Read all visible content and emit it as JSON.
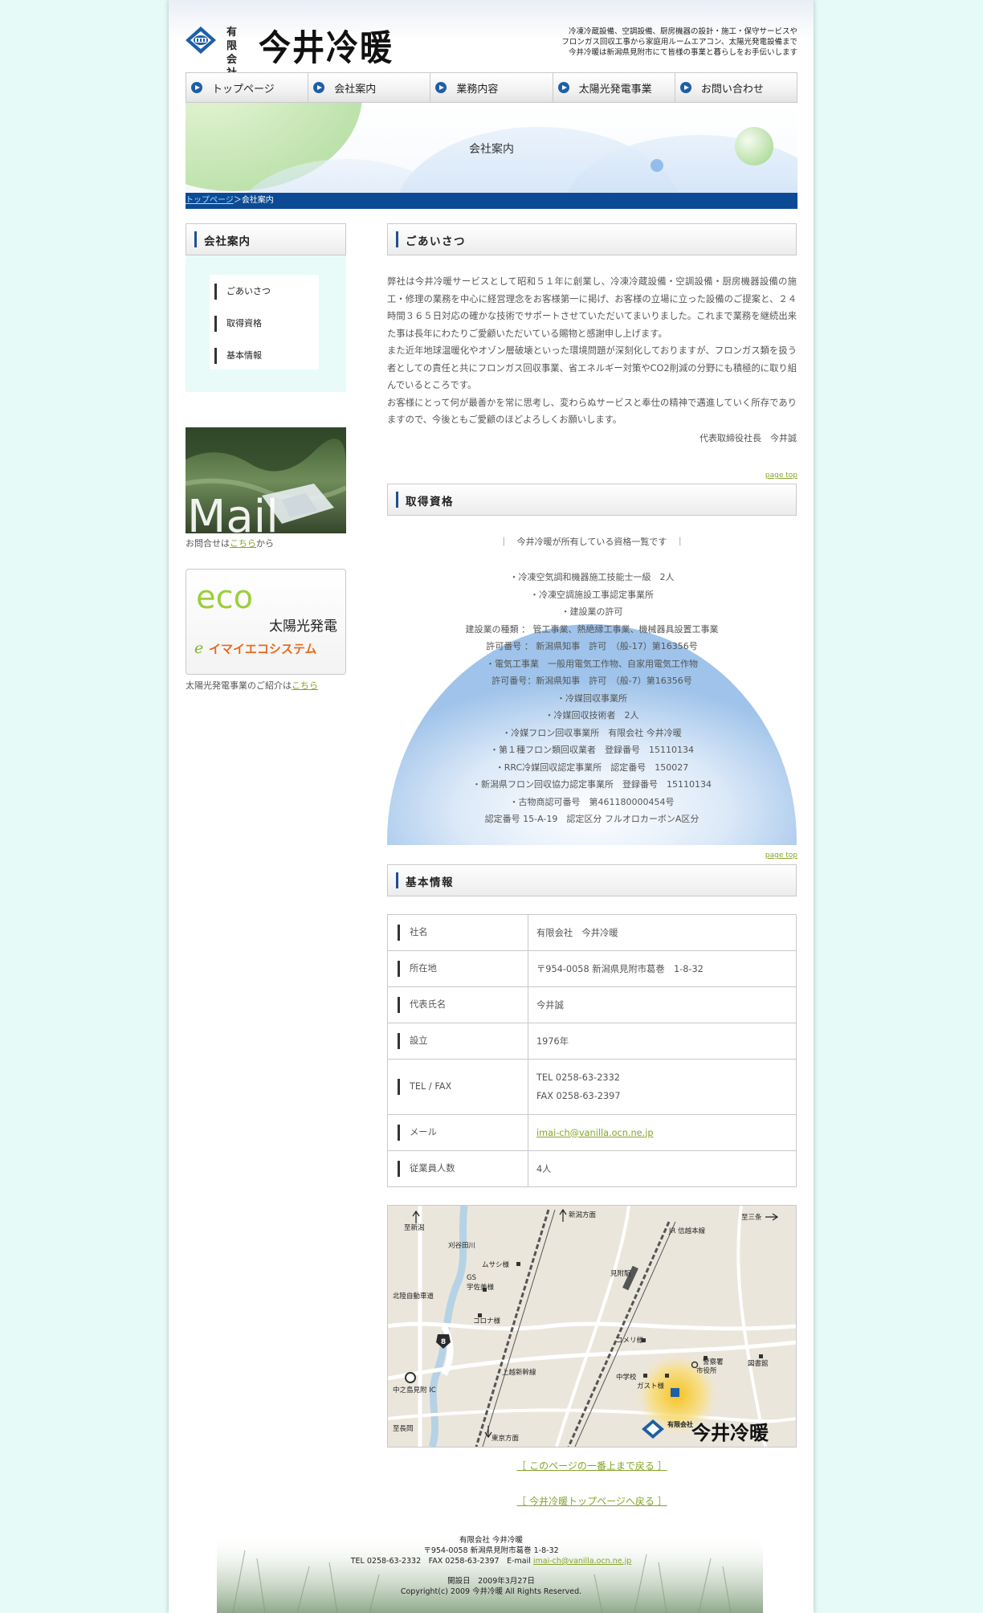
{
  "header": {
    "company_type": "有限会社",
    "company_name": "今井冷暖",
    "tagline": [
      "冷凍冷蔵設備、空調設備、厨房機器の設計・施工・保守サービスや",
      "フロンガス回収工事から家庭用ルームエアコン、太陽光発電設備まで",
      "今井冷暖は新潟県見附市にて皆様の事業と暮らしをお手伝いします"
    ]
  },
  "nav": {
    "items": [
      {
        "label": "トップページ",
        "icon": "arrow-circle-icon"
      },
      {
        "label": "会社案内",
        "icon": "arrow-circle-icon"
      },
      {
        "label": "業務内容",
        "icon": "arrow-circle-icon"
      },
      {
        "label": "太陽光発電事業",
        "icon": "arrow-circle-icon"
      },
      {
        "label": "お問い合わせ",
        "icon": "arrow-circle-icon"
      }
    ]
  },
  "banner": {
    "title": "会社案内"
  },
  "breadcrumb": {
    "home": "トップページ",
    "separator": "＞",
    "current": "会社案内"
  },
  "sidebar": {
    "heading": "会社案内",
    "menu": [
      "ごあいさつ",
      "取得資格",
      "基本情報"
    ],
    "mail_banner": {
      "text": "Mail"
    },
    "mail_note": {
      "prefix": "お問合せは",
      "link": "こちら",
      "suffix": "から"
    },
    "eco_banner": {
      "eco": "eco",
      "solar": "太陽光発電",
      "brand": "イマイエコシステム"
    },
    "eco_note": {
      "prefix": "太陽光発電事業のご紹介は",
      "link": "こちら"
    }
  },
  "greeting": {
    "heading": "ごあいさつ",
    "paragraphs": [
      "弊社は今井冷暖サービスとして昭和５１年に創業し、冷凍冷蔵設備・空調設備・厨房機器設備の施工・修理の業務を中心に経営理念をお客様第一に掲げ、お客様の立場に立った設備のご提案と、２４時間３６５日対応の確かな技術でサポートさせていただいてまいりました。これまで業務を継続出来た事は長年にわたりご愛顧いただいている賜物と感謝申し上げます。",
      "また近年地球温暖化やオゾン層破壊といった環境問題が深刻化しておりますが、フロンガス類を扱う者としての責任と共にフロンガス回収事業、省エネルギー対策やCO2削減の分野にも積極的に取り組んでいるところです。",
      "お客様にとって何が最善かを常に思考し、変わらぬサービスと奉仕の精神で邁進していく所存でありますので、今後ともご愛顧のほどよろしくお願いします。"
    ],
    "signature": "代表取締役社長　今井誠",
    "pagetop": "page top"
  },
  "qualifications": {
    "heading": "取得資格",
    "intro": "｜　今井冷暖が所有している資格一覧です　｜",
    "items": [
      "・冷凍空気調和機器施工技能士一級　2人",
      "・冷凍空調施設工事認定事業所",
      "・建設業の許可",
      "建設業の種類 ： 管工事業、熱絶縁工事業、機械器具設置工事業",
      "許可番号 ： 新潟県知事　許可　（般-17）第16356号",
      "・電気工事業　一般用電気工作物、自家用電気工作物",
      "許可番号：新潟県知事　許可　（般-7）第16356号",
      "・冷媒回収事業所",
      "・冷媒回収技術者　2人",
      "・冷媒フロン回収事業所　有限会社 今井冷暖",
      "・第１種フロン類回収業者　登録番号　15110134",
      "・RRC冷媒回収認定事業所　認定番号　150027",
      "・新潟県フロン回収協力認定事業所　登録番号　15110134",
      "・古物商認可番号　第461180000454号",
      "認定番号 15-A-19　認定区分 フルオロカーボンA区分"
    ],
    "pagetop": "page top"
  },
  "basic_info": {
    "heading": "基本情報",
    "rows": [
      {
        "key": "社名",
        "value": "有限会社　今井冷暖"
      },
      {
        "key": "所在地",
        "value": "〒954-0058 新潟県見附市葛巻　1-8-32"
      },
      {
        "key": "代表氏名",
        "value": "今井誠"
      },
      {
        "key": "設立",
        "value": "1976年"
      },
      {
        "key": "TEL / FAX",
        "value": "TEL 0258-63-2332",
        "value2": "FAX 0258-63-2397"
      },
      {
        "key": "メール",
        "value": "imai-ch@vanilla.ocn.ne.jp"
      },
      {
        "key": "従業員人数",
        "value": "4人"
      }
    ]
  },
  "map": {
    "labels": {
      "shiniwako": "至新潟",
      "niigata_dir": "新潟方面",
      "jr": "JR 信越本線",
      "sanjo": "至三条",
      "kariyata": "刈谷田川",
      "musashi": "ムサシ様",
      "gs": "GS",
      "usami": "宇佐美様",
      "mitsuke_st": "見附駅",
      "hokuriku": "北陸自動車道",
      "corona": "コロナ様",
      "route": "8",
      "komeri": "コメリ様",
      "police": "警察署",
      "cityhall": "市役所",
      "library": "図書館",
      "joetsu": "上越新幹線",
      "school": "中学校",
      "gust": "ガスト様",
      "ic": "中之島見附 IC",
      "nagaoka": "至長岡",
      "tokyo": "東京方面",
      "company": "今井冷暖",
      "company_type": "有限会社"
    }
  },
  "links": {
    "to_top": "［ このページの一番上まで戻る ］",
    "to_home": "［ 今井冷暖トップページへ戻る ］"
  },
  "footer": {
    "company": "有限会社 今井冷暖",
    "address": "〒954-0058 新潟県見附市葛巻 1-8-32",
    "tel_fax": "TEL 0258-63-2332　FAX 0258-63-2397　E-mail ",
    "email": "imai-ch@vanilla.ocn.ne.jp",
    "opened": "開設日　2009年3月27日",
    "copyright": "Copyright(c) 2009 今井冷暖 All Rights Reserved."
  },
  "colors": {
    "accent_blue": "#0c4a95",
    "link_green": "#85a52a",
    "mint_bg": "#e6fbf8"
  }
}
